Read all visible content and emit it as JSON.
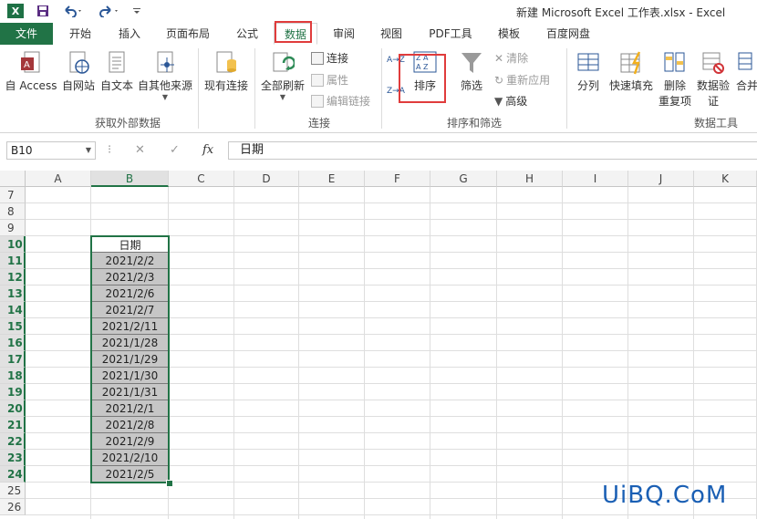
{
  "window": {
    "title": "新建 Microsoft Excel 工作表.xlsx - Excel"
  },
  "qat": {
    "logo": "X",
    "save_icon": "save-icon",
    "undo_icon": "undo-icon",
    "redo_icon": "redo-icon",
    "customize_icon": "customize-qat-icon"
  },
  "tabs": [
    {
      "label": "文件"
    },
    {
      "label": "开始"
    },
    {
      "label": "插入"
    },
    {
      "label": "页面布局"
    },
    {
      "label": "公式"
    },
    {
      "label": "数据"
    },
    {
      "label": "审阅"
    },
    {
      "label": "视图"
    },
    {
      "label": "PDF工具"
    },
    {
      "label": "模板"
    },
    {
      "label": "百度网盘"
    }
  ],
  "active_tab": "数据",
  "ribbon": {
    "get_external": {
      "label": "获取外部数据",
      "buttons": [
        {
          "label": "自 Access",
          "icon": "access-icon"
        },
        {
          "label": "自网站",
          "icon": "web-icon"
        },
        {
          "label": "自文本",
          "icon": "text-file-icon"
        },
        {
          "label": "自其他来源",
          "icon": "other-source-icon"
        }
      ],
      "existing": {
        "label": "现有连接",
        "icon": "existing-connection-icon"
      }
    },
    "connections": {
      "label": "连接",
      "refresh_all": "全部刷新",
      "connections": "连接",
      "properties": "属性",
      "edit_links": "编辑链接"
    },
    "sort_filter": {
      "label": "排序和筛选",
      "sort_az": "A→Z",
      "sort_za": "Z→A",
      "sort": "排序",
      "filter": "筛选",
      "clear": "清除",
      "reapply": "重新应用",
      "advanced": "高级"
    },
    "data_tools": {
      "label": "数据工具",
      "split": "分列",
      "flash_fill": "快速填充",
      "remove_dup_1": "删除",
      "remove_dup_2": "重复项",
      "validation_1": "数据验",
      "validation_2": "证",
      "consolidate": "合并"
    }
  },
  "formula_bar": {
    "name_box": "B10",
    "fx": "fx",
    "cancel": "✕",
    "enter": "✓",
    "content": "日期"
  },
  "columns": [
    "A",
    "B",
    "C",
    "D",
    "E",
    "F",
    "G",
    "H",
    "I",
    "J",
    "K"
  ],
  "selected_column": "B",
  "rows": [
    "7",
    "8",
    "9",
    "10",
    "11",
    "12",
    "13",
    "14",
    "15",
    "16",
    "17",
    "18",
    "19",
    "20",
    "21",
    "22",
    "23",
    "24",
    "25",
    "26"
  ],
  "column_b": {
    "header": "日期",
    "values": [
      "2021/2/2",
      "2021/2/3",
      "2021/2/6",
      "2021/2/7",
      "2021/2/11",
      "2021/1/28",
      "2021/1/29",
      "2021/1/30",
      "2021/1/31",
      "2021/2/1",
      "2021/2/8",
      "2021/2/9",
      "2021/2/10",
      "2021/2/5"
    ]
  },
  "watermark": "UiBQ.CoM"
}
